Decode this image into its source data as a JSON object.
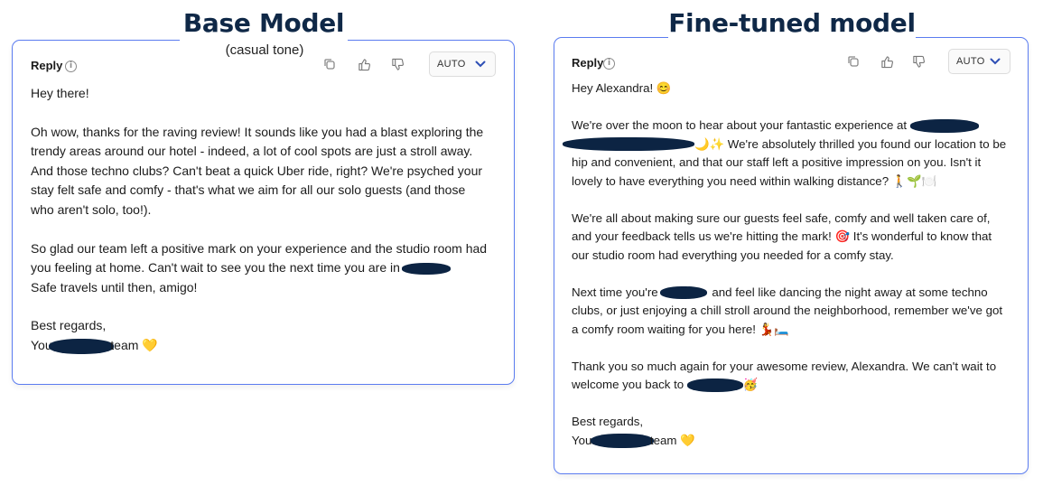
{
  "left": {
    "heading": "Base Model",
    "subheading": "(casual tone)",
    "reply_label": "Reply",
    "auto_label": "AUTO",
    "body": {
      "greeting": "Hey there!",
      "p1": "Oh wow, thanks for the raving review! It sounds like you had a blast exploring the trendy areas around our hotel - indeed, a lot of cool spots are just a stroll away. And those techno clubs? Can't beat a quick Uber ride, right? We're psyched your stay felt safe and comfy - that's what we aim for all our solo guests (and those who aren't solo, too!).",
      "p2a": "So glad our team left a positive mark on your experience and the studio room had you feeling at home. Can't wait to see you the next time you are in",
      "p2b": "Safe travels until then, amigo!",
      "signoff": "Best regards,",
      "sig_prefix": "Your",
      "sig_suffix": "team 💛"
    }
  },
  "right": {
    "heading": "Fine-tuned model",
    "reply_label": "Reply",
    "auto_label": "AUTO",
    "body": {
      "greeting": "Hey Alexandra! 😊",
      "p1a": "We're over the moon to hear about your fantastic experience at",
      "p1b": "🌙✨ We're absolutely thrilled you found our location to be hip and convenient, and that our staff left a positive impression on you. Isn't it lovely to have everything you need within walking distance? 🚶🌱🍽️",
      "p2": "We're all about making sure our guests feel safe, comfy and well taken care of, and your feedback tells us we're hitting the mark! 🎯 It's wonderful to know that our studio room had everything you needed for a comfy stay.",
      "p3a": "Next time you're",
      "p3b": "and feel like dancing the night away at some techno clubs, or just enjoying a chill stroll around the neighborhood, remember we've got a comfy room waiting for you here! 💃🛏️",
      "p4a": "Thank you so much again for your awesome review, Alexandra. We can't wait to welcome you back to",
      "p4b": "🥳",
      "signoff": "Best regards,",
      "sig_prefix": "Your",
      "sig_suffix": "team 💛"
    }
  },
  "colors": {
    "panel_border": "#5b7cf0",
    "heading": "#0f2847",
    "redaction": "#0c2443"
  },
  "icons": [
    "info-icon",
    "copy-icon",
    "thumbs-up-icon",
    "thumbs-down-icon",
    "chevron-down-icon"
  ]
}
